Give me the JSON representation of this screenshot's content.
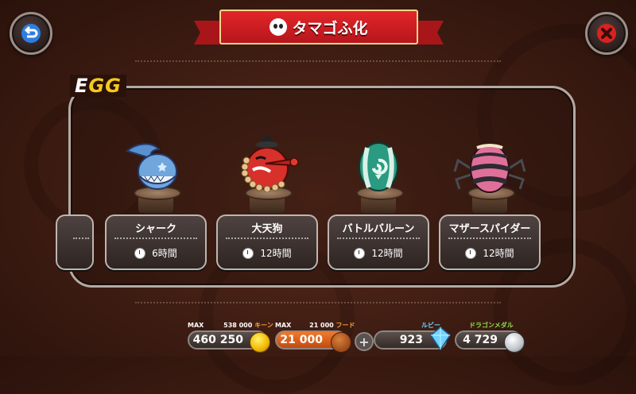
{
  "header": {
    "title": "タマゴふ化"
  },
  "section_label": {
    "e": "E",
    "gg": "GG"
  },
  "eggs": [
    {
      "name": "シャーク",
      "time": "6時間",
      "color": "#6fa6dc"
    },
    {
      "name": "大天狗",
      "time": "12時間",
      "color": "#d8302a"
    },
    {
      "name": "バトルバルーン",
      "time": "12時間",
      "color": "#2a9a80"
    },
    {
      "name": "マザースパイダー",
      "time": "12時間",
      "color": "#e0709a"
    }
  ],
  "resources": {
    "gold": {
      "max_label": "MAX",
      "max_value": "538 000",
      "unit": "キーン",
      "value": "460 250"
    },
    "food": {
      "max_label": "MAX",
      "max_value": "21 000",
      "unit": "フード",
      "value": "21 000"
    },
    "ruby": {
      "label": "ルビー",
      "value": "923"
    },
    "medal": {
      "label": "ドラゴンメダル",
      "value": "4 729"
    }
  },
  "icons": {
    "back": "back-arrow-icon",
    "close": "close-x-icon",
    "plus": "plus-icon"
  },
  "colors": {
    "banner_red": "#d41f24",
    "egg_label_yellow": "#f5c91e",
    "close_red": "#d8231f",
    "back_blue": "#2f7de0"
  }
}
